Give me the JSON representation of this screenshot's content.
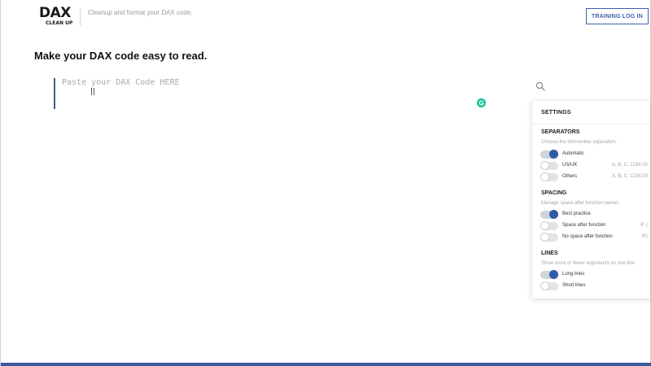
{
  "header": {
    "logo_main": "DAX",
    "logo_sub": "CLEAN UP",
    "tagline": "Cleanup and format your DAX code.",
    "login_label": "TRAINING LOG IN"
  },
  "main": {
    "title": "Make your DAX code easy to read.",
    "editor_placeholder": "Paste your DAX Code HERE"
  },
  "settings": {
    "title": "SETTINGS",
    "sections": [
      {
        "title": "SEPARATORS",
        "description": "Choose the list/number separators.",
        "options": [
          {
            "label": "Automatic",
            "hint": "",
            "on": true
          },
          {
            "label": "US/UK",
            "hint": "A, B, C, 1234.00",
            "on": false
          },
          {
            "label": "Others",
            "hint": "A; B; C; 1234,00",
            "on": false
          }
        ]
      },
      {
        "title": "SPACING",
        "description": "Manage space after function names.",
        "options": [
          {
            "label": "Best practice",
            "hint": "",
            "on": true
          },
          {
            "label": "Space after function",
            "hint": "IF (",
            "on": false
          },
          {
            "label": "No space after function",
            "hint": "IF(",
            "on": false
          }
        ]
      },
      {
        "title": "LINES",
        "description": "Show more or fewer arguments on one line.",
        "options": [
          {
            "label": "Long lines",
            "hint": "",
            "on": true
          },
          {
            "label": "Short lines",
            "hint": "",
            "on": false
          }
        ]
      }
    ]
  },
  "colors": {
    "accent": "#3d5fb0",
    "toggle_on": "#2f5aa8",
    "editor_bar": "#3a5c96",
    "grammarly": "#15c39a"
  },
  "icons": {
    "search": "search-icon",
    "grammarly": "grammarly-icon",
    "text_cursor": "text-cursor-icon"
  }
}
